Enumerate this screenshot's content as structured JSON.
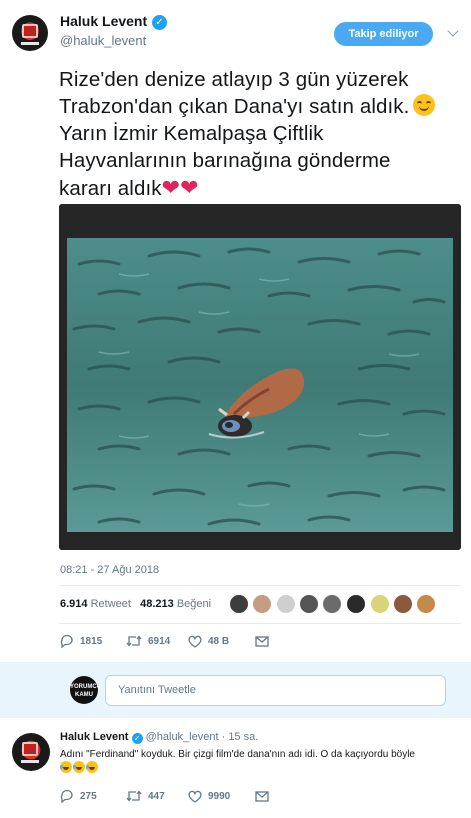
{
  "tweet": {
    "author_name": "Haluk Levent",
    "author_handle": "@haluk_levent",
    "follow_label": "Takip ediliyor",
    "text_lines": [
      "Rize'den denize atlayıp 3 gün yüzerek",
      "Trabzon'dan çıkan Dana'yı satın aldık.",
      "Yarın İzmir Kemalpaşa Çiftlik",
      "Hayvanlarının barınağına gönderme",
      "kararı aldık"
    ],
    "emoji_after_line2": "smiling-face-with-smiling-eyes",
    "emoji_after_line5": [
      "red-heart",
      "red-heart"
    ],
    "heart_glyph": "❤",
    "timestamp": "08:21 - 27 Ağu 2018",
    "retweet_count": "6.914",
    "retweet_label": "Retweet",
    "like_count": "48.213",
    "like_label": "Beğeni",
    "actions": {
      "reply_count": "1815",
      "retweet_count": "6914",
      "like_count": "48 B"
    }
  },
  "reply_box": {
    "avatar_text_1": "YORUMCU",
    "avatar_text_2": "KAMU",
    "placeholder": "Yanıtını Tweetle"
  },
  "reply_tweet": {
    "author_name": "Haluk Levent",
    "author_handle": "@haluk_levent",
    "time_ago": "· 15 sa.",
    "text": "Adını \"Ferdinand\" koyduk. Bir çizgi film'de dana'nın adı idi. O da kaçıyordu böyle",
    "emojis": [
      "face-with-tears-of-joy",
      "face-with-tears-of-joy",
      "face-with-tears-of-joy"
    ],
    "actions": {
      "reply_count": "275",
      "retweet_count": "447",
      "like_count": "9990"
    }
  },
  "colors": {
    "accent": "#1da1f2",
    "follow_button": "#4aa9f3",
    "muted_text": "#657786",
    "reply_box_bg": "#e8f5fd",
    "heart": "#e0245e",
    "water": "#3f7a76"
  }
}
